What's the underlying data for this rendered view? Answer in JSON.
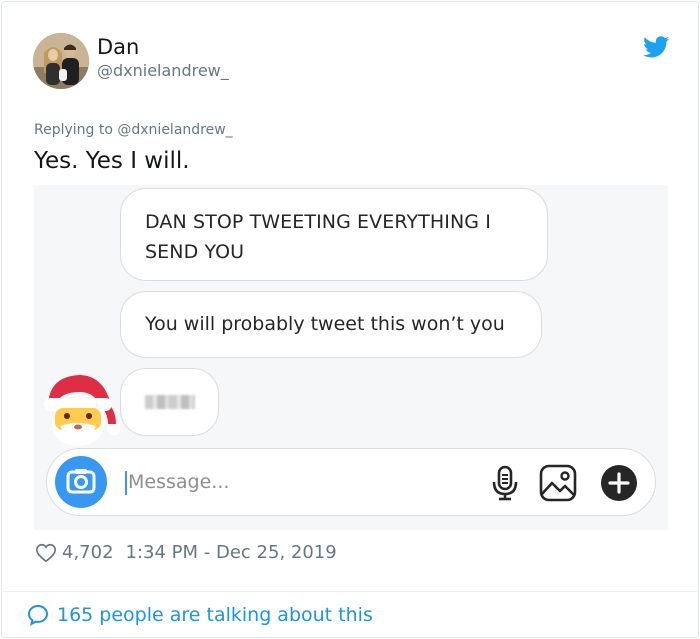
{
  "tweet": {
    "display_name": "Dan",
    "handle": "@dxnielandrew_",
    "replying_to": "Replying to @dxnielandrew_",
    "text": "Yes. Yes I will."
  },
  "conversation": {
    "messages": [
      "DAN STOP TWEETING EVERYTHING I SEND YOU",
      "You will probably tweet this won’t you"
    ],
    "composer_placeholder": "Message..."
  },
  "footer": {
    "likes": "4,702",
    "timestamp": "1:34 PM - Dec 25, 2019",
    "talking": "165 people are talking about this"
  },
  "icons": {
    "brand": "twitter-bird-icon",
    "like": "heart-icon",
    "reply": "comment-bubble-icon",
    "camera": "camera-icon",
    "mic": "microphone-icon",
    "gallery": "image-icon",
    "more": "plus-icon",
    "emoji": "santa-emoji"
  },
  "colors": {
    "twitter_blue": "#1da1f2",
    "link_blue": "#1b95e0",
    "instagram_blue": "#3897f0",
    "muted_gray": "#657786"
  }
}
